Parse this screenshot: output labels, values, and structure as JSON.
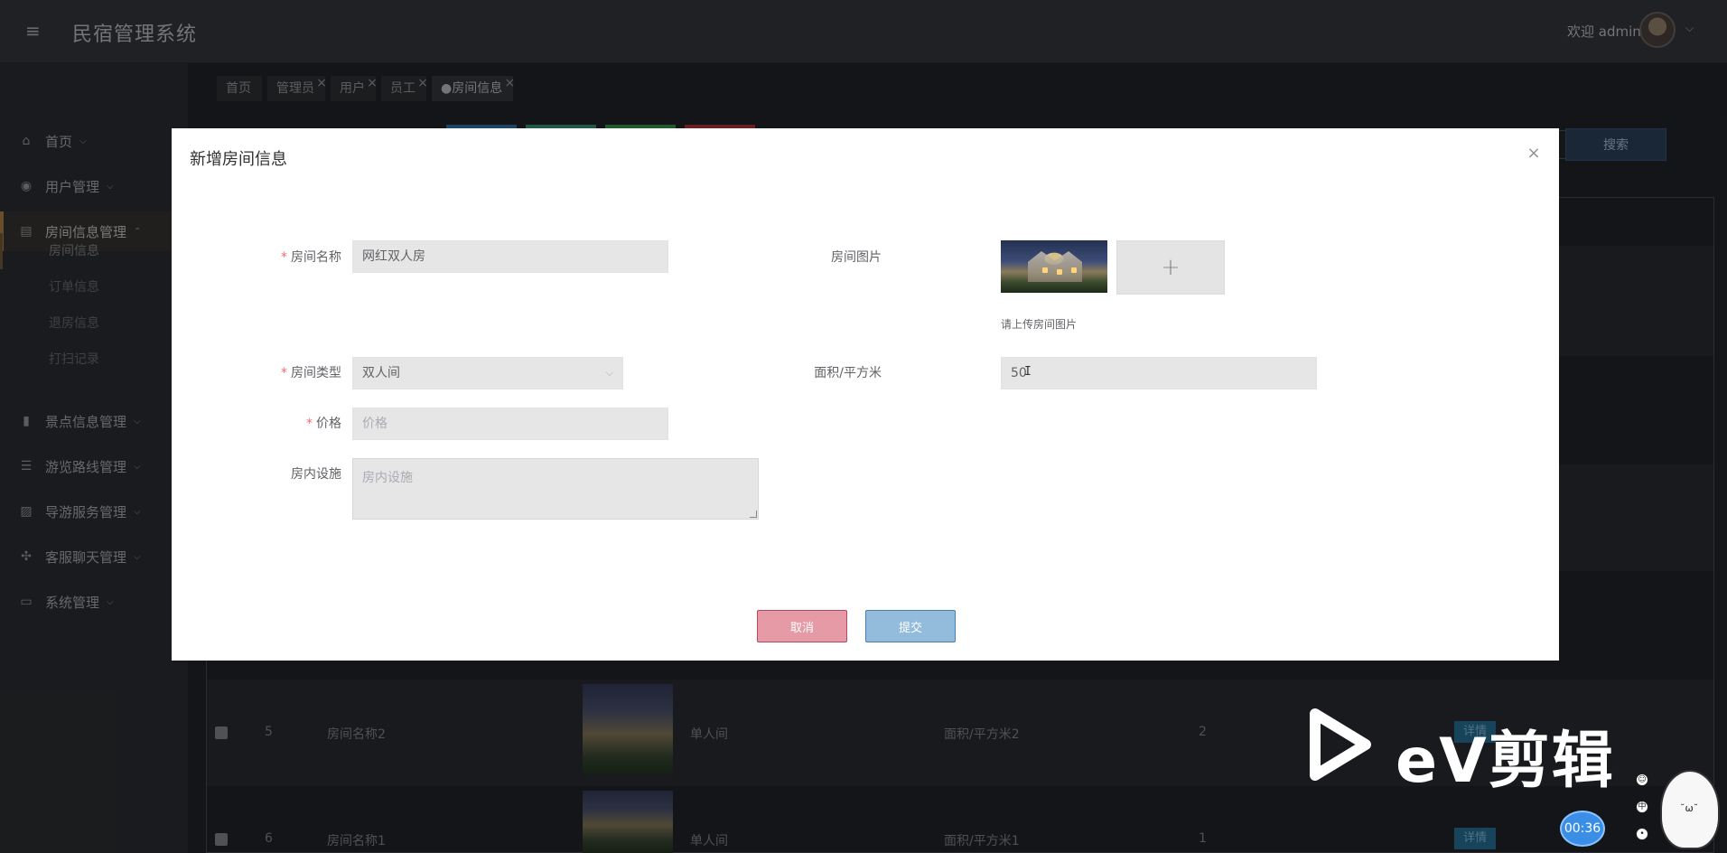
{
  "header": {
    "app_title": "民宿管理系统",
    "welcome": "欢迎 admin"
  },
  "sidebar": {
    "items": [
      {
        "label": "首页",
        "icon": "home-icon"
      },
      {
        "label": "用户管理",
        "icon": "compass-icon"
      },
      {
        "label": "房间信息管理",
        "icon": "shop-icon"
      },
      {
        "label": "景点信息管理",
        "icon": "document-icon"
      },
      {
        "label": "游览路线管理",
        "icon": "list-icon"
      },
      {
        "label": "导游服务管理",
        "icon": "picture-icon"
      },
      {
        "label": "客服聊天管理",
        "icon": "grid-icon"
      },
      {
        "label": "系统管理",
        "icon": "monitor-icon"
      }
    ],
    "sub_items": [
      "房间信息",
      "订单信息",
      "退房信息",
      "打扫记录"
    ]
  },
  "tabs": [
    {
      "label": "首页",
      "closable": false
    },
    {
      "label": "管理员",
      "closable": true
    },
    {
      "label": "用户",
      "closable": true
    },
    {
      "label": "员工",
      "closable": true
    },
    {
      "label": "●房间信息",
      "closable": true,
      "active": true
    }
  ],
  "toolbar": {
    "search_label": "搜索"
  },
  "table": {
    "rows": [
      {
        "index": "5",
        "name": "房间名称2",
        "type": "单人间",
        "area": "面积/平方米2",
        "count": "2",
        "detail": "详情"
      },
      {
        "index": "6",
        "name": "房间名称1",
        "type": "单人间",
        "area": "面积/平方米1",
        "count": "1",
        "detail": "详情"
      }
    ]
  },
  "dialog": {
    "title": "新增房间信息",
    "fields": {
      "room_name": {
        "label": "房间名称",
        "required": true,
        "value": "网红双人房"
      },
      "room_image": {
        "label": "房间图片",
        "hint": "请上传房间图片"
      },
      "room_type": {
        "label": "房间类型",
        "required": true,
        "value": "双人间"
      },
      "area": {
        "label": "面积/平方米",
        "value": "50"
      },
      "price": {
        "label": "价格",
        "required": true,
        "placeholder": "价格"
      },
      "facilities": {
        "label": "房内设施",
        "placeholder": "房内设施"
      }
    },
    "cancel_label": "取消",
    "submit_label": "提交"
  },
  "watermark": {
    "text": "eV剪辑",
    "timer": "00:36"
  },
  "colors": {
    "required": "#f56c6c",
    "cancel": "#e59aa5",
    "submit": "#93bbdb",
    "accent": "#3a8ee6"
  }
}
